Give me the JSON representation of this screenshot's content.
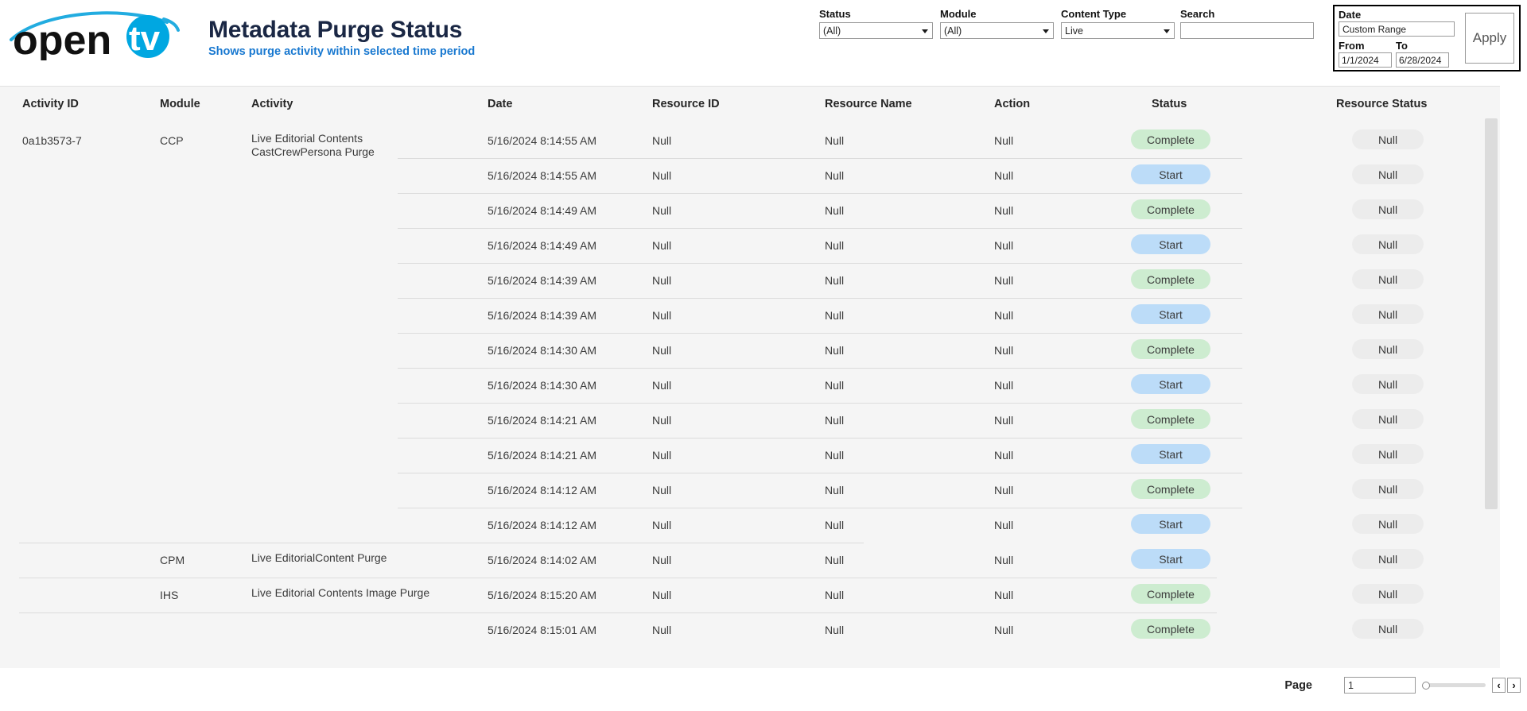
{
  "brand": {
    "logo_text_open": "open",
    "logo_text_tv": "tv",
    "logo_color_cyan": "#22ace0",
    "logo_color_dark": "#111111"
  },
  "header": {
    "title": "Metadata Purge Status",
    "subtitle": "Shows purge activity within selected time period",
    "title_color": "#1a2744",
    "subtitle_color": "#1878d0"
  },
  "filters": {
    "status": {
      "label": "Status",
      "value": "(All)"
    },
    "module": {
      "label": "Module",
      "value": "(All)"
    },
    "content_type": {
      "label": "Content Type",
      "value": "Live"
    },
    "search": {
      "label": "Search",
      "value": "",
      "placeholder": ""
    }
  },
  "date_panel": {
    "label": "Date",
    "range_value": "Custom Range",
    "from_label": "From",
    "to_label": "To",
    "from_value": "1/1/2024",
    "to_value": "6/28/2024",
    "apply_label": "Apply"
  },
  "table": {
    "columns": [
      "Activity ID",
      "Module",
      "Activity",
      "Date",
      "Resource ID",
      "Resource Name",
      "Action",
      "Status",
      "Resource Status"
    ],
    "rows": [
      {
        "activity_id": "0a1b3573-7",
        "module": "CCP",
        "activity": "Live Editorial Contents CastCrewPersona Purge",
        "date": "5/16/2024 8:14:55 AM",
        "resource_id": "Null",
        "resource_name": "Null",
        "action": "Null",
        "status": "Complete",
        "resource_status": "Null"
      },
      {
        "activity_id": "",
        "module": "",
        "activity": "",
        "date": "5/16/2024 8:14:55 AM",
        "resource_id": "Null",
        "resource_name": "Null",
        "action": "Null",
        "status": "Start",
        "resource_status": "Null"
      },
      {
        "activity_id": "",
        "module": "",
        "activity": "",
        "date": "5/16/2024 8:14:49 AM",
        "resource_id": "Null",
        "resource_name": "Null",
        "action": "Null",
        "status": "Complete",
        "resource_status": "Null"
      },
      {
        "activity_id": "",
        "module": "",
        "activity": "",
        "date": "5/16/2024 8:14:49 AM",
        "resource_id": "Null",
        "resource_name": "Null",
        "action": "Null",
        "status": "Start",
        "resource_status": "Null"
      },
      {
        "activity_id": "",
        "module": "",
        "activity": "",
        "date": "5/16/2024 8:14:39 AM",
        "resource_id": "Null",
        "resource_name": "Null",
        "action": "Null",
        "status": "Complete",
        "resource_status": "Null"
      },
      {
        "activity_id": "",
        "module": "",
        "activity": "",
        "date": "5/16/2024 8:14:39 AM",
        "resource_id": "Null",
        "resource_name": "Null",
        "action": "Null",
        "status": "Start",
        "resource_status": "Null"
      },
      {
        "activity_id": "",
        "module": "",
        "activity": "",
        "date": "5/16/2024 8:14:30 AM",
        "resource_id": "Null",
        "resource_name": "Null",
        "action": "Null",
        "status": "Complete",
        "resource_status": "Null"
      },
      {
        "activity_id": "",
        "module": "",
        "activity": "",
        "date": "5/16/2024 8:14:30 AM",
        "resource_id": "Null",
        "resource_name": "Null",
        "action": "Null",
        "status": "Start",
        "resource_status": "Null"
      },
      {
        "activity_id": "",
        "module": "",
        "activity": "",
        "date": "5/16/2024 8:14:21 AM",
        "resource_id": "Null",
        "resource_name": "Null",
        "action": "Null",
        "status": "Complete",
        "resource_status": "Null"
      },
      {
        "activity_id": "",
        "module": "",
        "activity": "",
        "date": "5/16/2024 8:14:21 AM",
        "resource_id": "Null",
        "resource_name": "Null",
        "action": "Null",
        "status": "Start",
        "resource_status": "Null"
      },
      {
        "activity_id": "",
        "module": "",
        "activity": "",
        "date": "5/16/2024 8:14:12 AM",
        "resource_id": "Null",
        "resource_name": "Null",
        "action": "Null",
        "status": "Complete",
        "resource_status": "Null"
      },
      {
        "activity_id": "",
        "module": "",
        "activity": "",
        "date": "5/16/2024 8:14:12 AM",
        "resource_id": "Null",
        "resource_name": "Null",
        "action": "Null",
        "status": "Start",
        "resource_status": "Null"
      },
      {
        "activity_id": "",
        "module": "CPM",
        "activity": "Live EditorialContent Purge",
        "date": "5/16/2024 8:14:02 AM",
        "resource_id": "Null",
        "resource_name": "Null",
        "action": "Null",
        "status": "Start",
        "resource_status": "Null"
      },
      {
        "activity_id": "",
        "module": "IHS",
        "activity": "Live Editorial Contents  Image Purge",
        "date": "5/16/2024 8:15:20 AM",
        "resource_id": "Null",
        "resource_name": "Null",
        "action": "Null",
        "status": "Complete",
        "resource_status": "Null"
      },
      {
        "activity_id": "",
        "module": "",
        "activity": "",
        "date": "5/16/2024 8:15:01 AM",
        "resource_id": "Null",
        "resource_name": "Null",
        "action": "Null",
        "status": "Complete",
        "resource_status": "Null"
      }
    ],
    "status_colors": {
      "Complete": "#cdecd0",
      "Start": "#bcdcf8"
    }
  },
  "pagination": {
    "page_label": "Page",
    "page_value": "1",
    "prev_label": "‹",
    "next_label": "›"
  }
}
